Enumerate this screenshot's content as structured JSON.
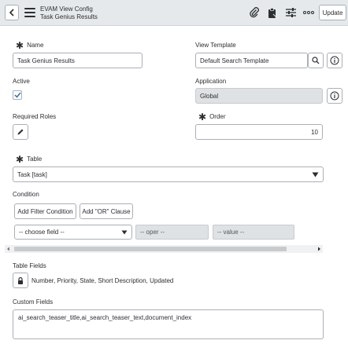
{
  "header": {
    "title": "EVAM View Config",
    "subtitle": "Task Genius Results",
    "update_label": "Update",
    "icons": [
      "back-icon",
      "menu-icon",
      "paperclip-icon",
      "clipboard-icon",
      "sliders-icon",
      "more-icon"
    ]
  },
  "form": {
    "name": {
      "label": "Name",
      "value": "Task Genius Results"
    },
    "view_template": {
      "label": "View Template",
      "value": "Default Search Template"
    },
    "active": {
      "label": "Active",
      "checked": true
    },
    "application": {
      "label": "Application",
      "value": "Global"
    },
    "required_roles": {
      "label": "Required Roles"
    },
    "order": {
      "label": "Order",
      "value": "10"
    },
    "table": {
      "label": "Table",
      "value": "Task [task]"
    },
    "condition": {
      "label": "Condition",
      "add_filter_label": "Add Filter Condition",
      "add_or_label": "Add \"OR\" Clause",
      "field_placeholder": "-- choose field --",
      "oper_placeholder": "-- oper --",
      "value_placeholder": "-- value --"
    },
    "table_fields": {
      "label": "Table Fields",
      "value": "Number, Priority, State, Short Description, Updated"
    },
    "custom_fields": {
      "label": "Custom Fields",
      "value": "ai_search_teaser_title,ai_search_teaser_text,document_index"
    }
  }
}
